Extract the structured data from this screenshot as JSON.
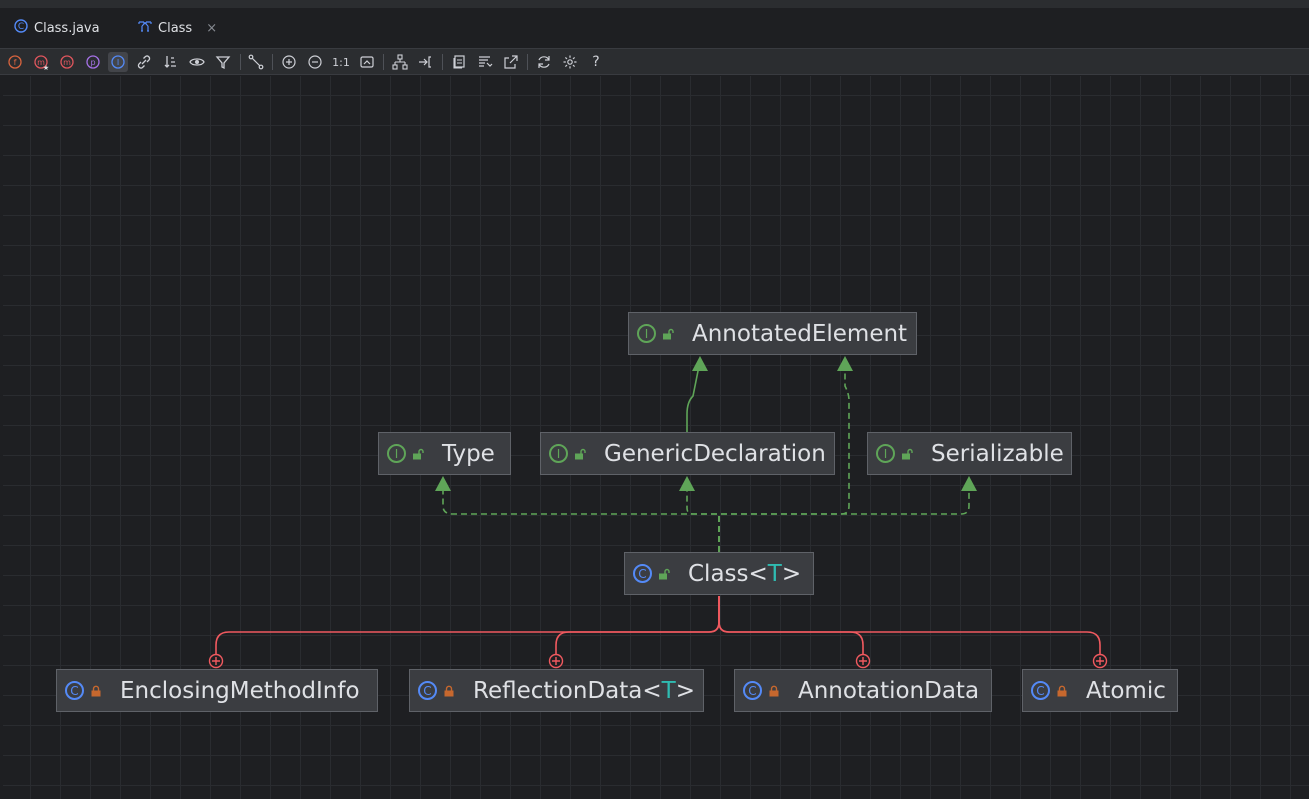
{
  "tabs": [
    {
      "label": "Class.java",
      "icon": "class-file-icon",
      "active": false
    },
    {
      "label": "Class",
      "icon": "diagram-icon",
      "active": true,
      "close": "×"
    }
  ],
  "toolbar": {
    "zoom_actual_label": "1:1",
    "help_label": "?",
    "buttons": [
      "fields-icon",
      "constructors-icon",
      "methods-icon",
      "properties-icon",
      "inner-classes-icon",
      "dependencies-icon",
      "sort-icon",
      "visibility-icon",
      "filter-icon",
      "edge-routing-icon",
      "zoom-in-icon",
      "zoom-out-icon",
      "actual-size-icon",
      "fit-content-icon",
      "layout-icon",
      "apply-layout-icon",
      "copy-diagram-icon",
      "select-members-icon",
      "export-icon",
      "refresh-icon",
      "settings-icon",
      "help-icon"
    ]
  },
  "colors": {
    "implements_edge": "#5fa558",
    "inner_class_edge": "#f0595f",
    "interface_icon": "#5fa558",
    "class_icon": "#548af7",
    "type_param": "#2fbcb2",
    "private_lock": "#c7682e",
    "public_lock": "#5fa558"
  },
  "diagram": {
    "nodes": {
      "annotated_element": {
        "name": "AnnotatedElement",
        "kind": "I",
        "visibility": "public"
      },
      "type": {
        "name": "Type",
        "kind": "I",
        "visibility": "public"
      },
      "generic_declaration": {
        "name": "GenericDeclaration",
        "kind": "I",
        "visibility": "public"
      },
      "serializable": {
        "name": "Serializable",
        "kind": "I",
        "visibility": "public"
      },
      "class": {
        "name": "Class<",
        "type_param": "T",
        "suffix": ">",
        "kind": "C",
        "visibility": "public"
      },
      "enclosing_method_info": {
        "name": "EnclosingMethodInfo",
        "kind": "C",
        "visibility": "private"
      },
      "reflection_data": {
        "name": "ReflectionData<",
        "type_param": "T",
        "suffix": ">",
        "kind": "C",
        "visibility": "private"
      },
      "annotation_data": {
        "name": "AnnotationData",
        "kind": "C",
        "visibility": "private"
      },
      "atomic": {
        "name": "Atomic",
        "kind": "C",
        "visibility": "private"
      }
    }
  }
}
